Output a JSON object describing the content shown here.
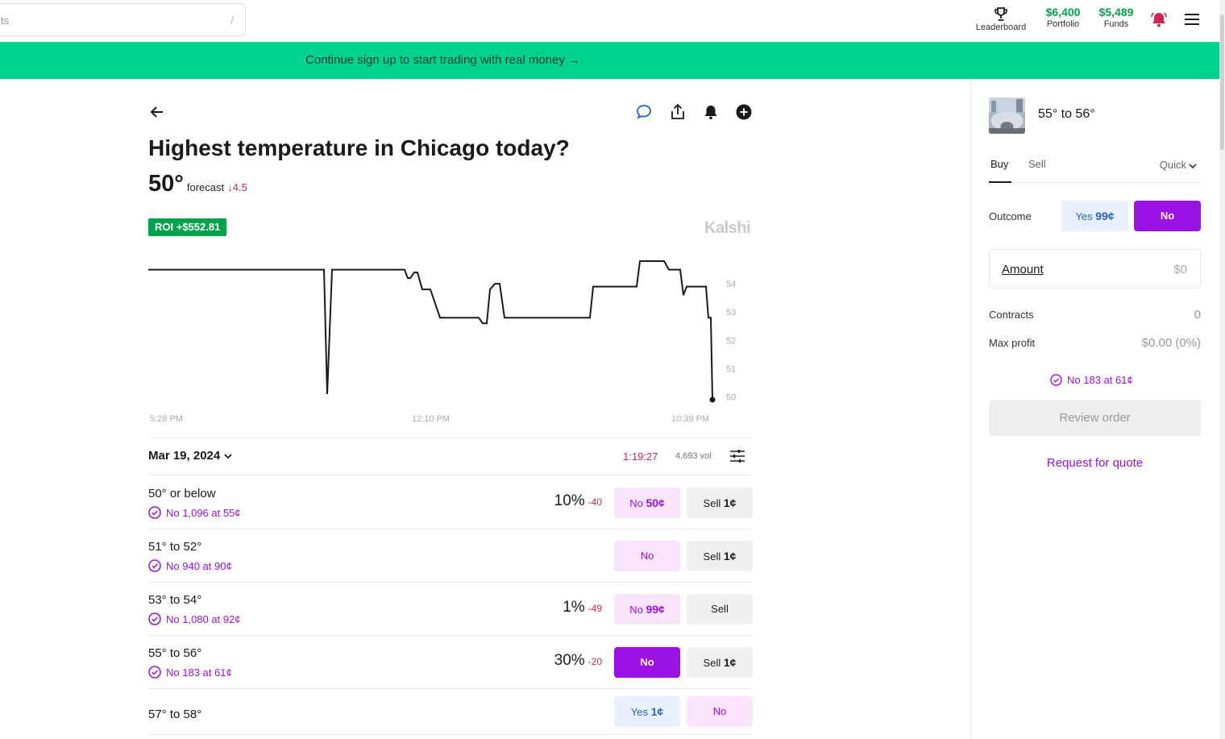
{
  "search": {
    "placeholder_fragment": "ts",
    "shortcut": "/"
  },
  "nav": {
    "leaderboard_label": "Leaderboard",
    "portfolio_value": "$6,400",
    "portfolio_label": "Portfolio",
    "funds_value": "$5,489",
    "funds_label": "Funds"
  },
  "banner": {
    "text": "Continue sign up to start trading with real money →"
  },
  "market": {
    "title": "Highest temperature in Chicago today?",
    "forecast_value": "50°",
    "forecast_label": "forecast",
    "forecast_change": "↓4.5",
    "roi": "ROI +$552.81",
    "brand": "Kalshi",
    "date": "Mar 19, 2024",
    "timer": "1:19:27",
    "volume": "4,693 vol"
  },
  "chart_data": {
    "type": "line",
    "title": "",
    "xlabel": "",
    "ylabel": "",
    "x_ticks": [
      "5:28 PM",
      "12:10 PM",
      "10:39 PM"
    ],
    "y_ticks": [
      54,
      53,
      52,
      51,
      50
    ],
    "ylim": [
      49.9,
      55.2
    ],
    "x": [
      0,
      218,
      222,
      228,
      318,
      322,
      325,
      330,
      334,
      340,
      345,
      350,
      362,
      366,
      410,
      415,
      420,
      424,
      430,
      436,
      442,
      446,
      548,
      552,
      606,
      610,
      614,
      622,
      640,
      646,
      650,
      660,
      664,
      668,
      672,
      692,
      695,
      698,
      700
    ],
    "values": [
      54.5,
      54.5,
      50.1,
      54.5,
      54.5,
      54.2,
      54.2,
      54.4,
      54.4,
      53.8,
      53.8,
      53.8,
      52.8,
      52.8,
      52.8,
      52.6,
      52.6,
      53.8,
      54.0,
      54.0,
      52.8,
      52.8,
      52.8,
      53.9,
      53.9,
      54.8,
      54.8,
      54.8,
      54.8,
      54.5,
      54.5,
      54.5,
      53.6,
      53.9,
      53.9,
      53.9,
      52.8,
      52.8,
      49.9
    ],
    "grid": false,
    "legend": "none"
  },
  "outcomes": [
    {
      "name": "50° or below",
      "position": "No 1,096 at 55¢",
      "pct": "10%",
      "delta": "-40",
      "btn1_label": "No",
      "btn1_price": "50¢",
      "btn1_style": "no",
      "btn2_label": "Sell",
      "btn2_price": "1¢",
      "btn2_style": "sell"
    },
    {
      "name": "51° to 52°",
      "position": "No 940 at 90¢",
      "pct": "",
      "delta": "",
      "btn1_label": "No",
      "btn1_price": "",
      "btn1_style": "no",
      "btn2_label": "Sell",
      "btn2_price": "1¢",
      "btn2_style": "sell"
    },
    {
      "name": "53° to 54°",
      "position": "No 1,080 at 92¢",
      "pct": "1%",
      "delta": "-49",
      "btn1_label": "No",
      "btn1_price": "99¢",
      "btn1_style": "no",
      "btn2_label": "Sell",
      "btn2_price": "",
      "btn2_style": "sell"
    },
    {
      "name": "55° to 56°",
      "position": "No 183 at 61¢",
      "pct": "30%",
      "delta": "-20",
      "btn1_label": "No",
      "btn1_price": "",
      "btn1_style": "no-active",
      "btn2_label": "Sell",
      "btn2_price": "1¢",
      "btn2_style": "sell"
    },
    {
      "name": "57° to 58°",
      "position": "",
      "pct": "",
      "delta": "",
      "btn1_label": "Yes",
      "btn1_price": "1¢",
      "btn1_style": "yes",
      "btn2_label": "No",
      "btn2_price": "",
      "btn2_style": "no"
    }
  ],
  "order": {
    "title": "55° to 56°",
    "tab_buy": "Buy",
    "tab_sell": "Sell",
    "mode": "Quick",
    "outcome_label": "Outcome",
    "yes_label": "Yes",
    "yes_price": "99¢",
    "no_label": "No",
    "amount_label": "Amount",
    "amount_value": "$0",
    "contracts_label": "Contracts",
    "contracts_value": "0",
    "max_profit_label": "Max profit",
    "max_profit_value": "$0.00 (0%)",
    "position": "No 183 at 61¢",
    "review_label": "Review order",
    "rfq_label": "Request for quote"
  },
  "colors": {
    "accent": "#9b10e5",
    "green": "#00a34a",
    "banner": "#00d38f",
    "red": "#d2254e",
    "blue": "#2563c8"
  }
}
